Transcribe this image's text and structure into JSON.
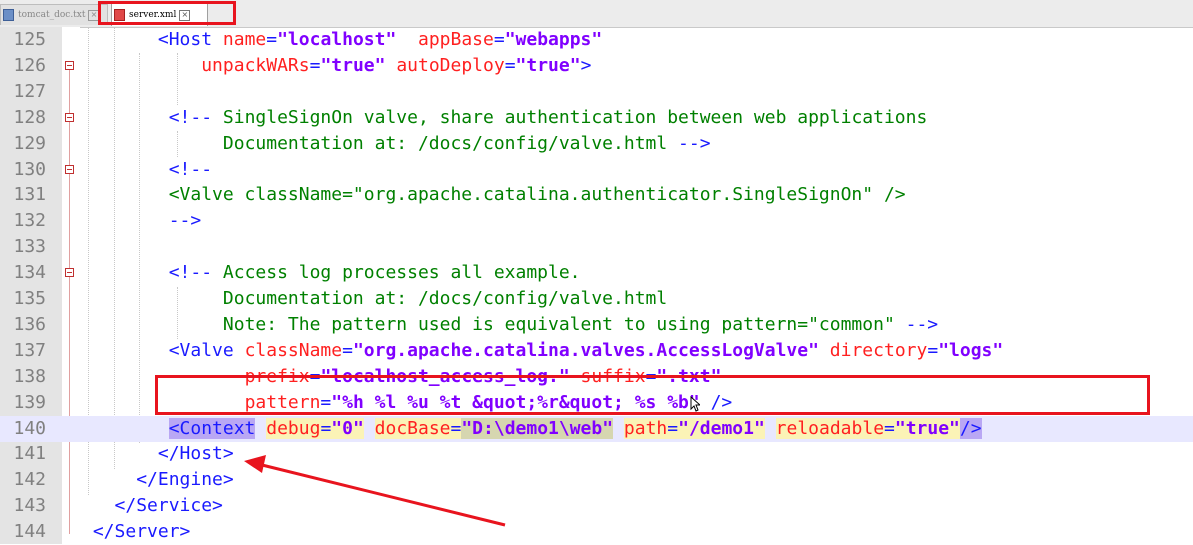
{
  "tabs": [
    {
      "label": "tomcat_doc.txt",
      "icon": "text-file-icon"
    },
    {
      "label": "server.xml",
      "icon": "xml-file-icon"
    }
  ],
  "lines": [
    {
      "n": "125",
      "indent": "       ",
      "segs": [
        [
          "tag",
          "<Host "
        ],
        [
          "attr",
          "name"
        ],
        [
          "tag",
          "="
        ],
        [
          "val",
          "\"localhost\""
        ],
        [
          "tag",
          "  "
        ],
        [
          "attr",
          "appBase"
        ],
        [
          "tag",
          "="
        ],
        [
          "val",
          "\"webapps\""
        ]
      ]
    },
    {
      "n": "126",
      "indent": "           ",
      "segs": [
        [
          "attr",
          "unpackWARs"
        ],
        [
          "tag",
          "="
        ],
        [
          "val",
          "\"true\""
        ],
        [
          "tag",
          " "
        ],
        [
          "attr",
          "autoDeploy"
        ],
        [
          "tag",
          "="
        ],
        [
          "val",
          "\"true\""
        ],
        [
          "tag",
          ">"
        ]
      ]
    },
    {
      "n": "127",
      "indent": "",
      "segs": []
    },
    {
      "n": "128",
      "indent": "        ",
      "segs": [
        [
          "tag",
          "<!--"
        ],
        [
          "cmt",
          " SingleSignOn valve, share authentication between web applications"
        ]
      ]
    },
    {
      "n": "129",
      "indent": "             ",
      "segs": [
        [
          "cmt",
          "Documentation at: /docs/config/valve.html "
        ],
        [
          "tag",
          "-->"
        ]
      ]
    },
    {
      "n": "130",
      "indent": "        ",
      "segs": [
        [
          "tag",
          "<!--"
        ]
      ]
    },
    {
      "n": "131",
      "indent": "        ",
      "segs": [
        [
          "cmt",
          "<Valve className=\"org.apache.catalina.authenticator.SingleSignOn\" />"
        ]
      ]
    },
    {
      "n": "132",
      "indent": "        ",
      "segs": [
        [
          "tag",
          "-->"
        ]
      ]
    },
    {
      "n": "133",
      "indent": "",
      "segs": []
    },
    {
      "n": "134",
      "indent": "        ",
      "segs": [
        [
          "tag",
          "<!--"
        ],
        [
          "cmt",
          " Access log processes all example."
        ]
      ]
    },
    {
      "n": "135",
      "indent": "             ",
      "segs": [
        [
          "cmt",
          "Documentation at: /docs/config/valve.html"
        ]
      ]
    },
    {
      "n": "136",
      "indent": "             ",
      "segs": [
        [
          "cmt",
          "Note: The pattern used is equivalent to using pattern=\"common\" "
        ],
        [
          "tag",
          "-->"
        ]
      ]
    },
    {
      "n": "137",
      "indent": "        ",
      "segs": [
        [
          "tag",
          "<Valve "
        ],
        [
          "attr",
          "className"
        ],
        [
          "tag",
          "="
        ],
        [
          "val",
          "\"org.apache.catalina.valves.AccessLogValve\""
        ],
        [
          "tag",
          " "
        ],
        [
          "attr",
          "directory"
        ],
        [
          "tag",
          "="
        ],
        [
          "val",
          "\"logs\""
        ]
      ]
    },
    {
      "n": "138",
      "indent": "               ",
      "segs": [
        [
          "attr",
          "prefix"
        ],
        [
          "tag",
          "="
        ],
        [
          "val",
          "\"localhost_access_log.\""
        ],
        [
          "tag",
          " "
        ],
        [
          "attr",
          "suffix"
        ],
        [
          "tag",
          "="
        ],
        [
          "val",
          "\".txt\""
        ]
      ]
    },
    {
      "n": "139",
      "indent": "               ",
      "segs": [
        [
          "attr",
          "pattern"
        ],
        [
          "tag",
          "="
        ],
        [
          "val",
          "\"%h %l %u %t &quot;%r&quot; %s %b\""
        ],
        [
          "tag",
          " />"
        ]
      ]
    },
    {
      "n": "140",
      "indent": "        ",
      "current": true,
      "segs": [
        [
          "tag hlt",
          "<Context"
        ],
        [
          "tag",
          " "
        ],
        [
          "attr hl",
          "debug"
        ],
        [
          "tag hl",
          "="
        ],
        [
          "val hl",
          "\"0\""
        ],
        [
          "tag",
          " "
        ],
        [
          "attr hl",
          "docBase"
        ],
        [
          "tag hl",
          "="
        ],
        [
          "val hl2",
          "\"D:\\demo1\\web\""
        ],
        [
          "tag",
          " "
        ],
        [
          "attr hl",
          "path"
        ],
        [
          "tag hl",
          "="
        ],
        [
          "val hl",
          "\"/demo1\""
        ],
        [
          "tag",
          " "
        ],
        [
          "attr hl",
          "reloadable"
        ],
        [
          "tag hl",
          "="
        ],
        [
          "val hl",
          "\"true\""
        ],
        [
          "tag hlt",
          "/>"
        ]
      ]
    },
    {
      "n": "141",
      "indent": "       ",
      "segs": [
        [
          "tag",
          "</Host>"
        ]
      ]
    },
    {
      "n": "142",
      "indent": "     ",
      "segs": [
        [
          "tag",
          "</Engine>"
        ]
      ]
    },
    {
      "n": "143",
      "indent": "   ",
      "segs": [
        [
          "tag",
          "</Service>"
        ]
      ]
    },
    {
      "n": "144",
      "indent": " ",
      "segs": [
        [
          "tag",
          "</Server>"
        ]
      ]
    }
  ],
  "fold_lines": [
    "126",
    "128",
    "130",
    "134"
  ],
  "colors": {
    "highlight_box": "#e8141e",
    "arrow": "#e8141e"
  }
}
